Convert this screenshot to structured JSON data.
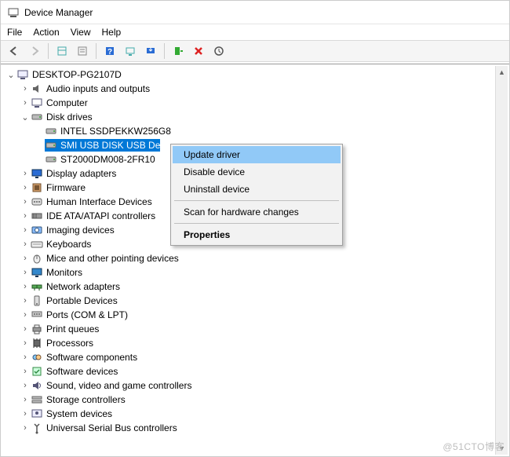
{
  "title": "Device Manager",
  "menubar": [
    "File",
    "Action",
    "View",
    "Help"
  ],
  "toolbar": [
    {
      "name": "back-icon"
    },
    {
      "name": "forward-icon"
    },
    {
      "sep": true
    },
    {
      "name": "show-hidden-icon"
    },
    {
      "name": "properties-pane-icon"
    },
    {
      "sep": true
    },
    {
      "name": "help-icon"
    },
    {
      "name": "scan-icon"
    },
    {
      "name": "update-icon"
    },
    {
      "sep": true
    },
    {
      "name": "add-legacy-icon"
    },
    {
      "name": "uninstall-icon"
    },
    {
      "name": "refresh-icon"
    }
  ],
  "root": {
    "label": "DESKTOP-PG2107D",
    "children": [
      {
        "label": "Audio inputs and outputs",
        "icon": "audio-icon",
        "expanded": false
      },
      {
        "label": "Computer",
        "icon": "computer-icon",
        "expanded": false
      },
      {
        "label": "Disk drives",
        "icon": "disk-icon",
        "expanded": true,
        "children": [
          {
            "label": "INTEL SSDPEKKW256G8",
            "icon": "disk-icon"
          },
          {
            "label": "SMI USB DISK USB De",
            "icon": "disk-icon",
            "selected": true
          },
          {
            "label": "ST2000DM008-2FR10",
            "icon": "disk-icon"
          }
        ]
      },
      {
        "label": "Display adapters",
        "icon": "display-icon",
        "expanded": false
      },
      {
        "label": "Firmware",
        "icon": "firmware-icon",
        "expanded": false
      },
      {
        "label": "Human Interface Devices",
        "icon": "hid-icon",
        "expanded": false
      },
      {
        "label": "IDE ATA/ATAPI controllers",
        "icon": "ide-icon",
        "expanded": false
      },
      {
        "label": "Imaging devices",
        "icon": "imaging-icon",
        "expanded": false
      },
      {
        "label": "Keyboards",
        "icon": "keyboard-icon",
        "expanded": false
      },
      {
        "label": "Mice and other pointing devices",
        "icon": "mouse-icon",
        "expanded": false
      },
      {
        "label": "Monitors",
        "icon": "monitor-icon",
        "expanded": false
      },
      {
        "label": "Network adapters",
        "icon": "network-icon",
        "expanded": false
      },
      {
        "label": "Portable Devices",
        "icon": "portable-icon",
        "expanded": false
      },
      {
        "label": "Ports (COM & LPT)",
        "icon": "ports-icon",
        "expanded": false
      },
      {
        "label": "Print queues",
        "icon": "print-icon",
        "expanded": false
      },
      {
        "label": "Processors",
        "icon": "processor-icon",
        "expanded": false
      },
      {
        "label": "Software components",
        "icon": "swcomp-icon",
        "expanded": false
      },
      {
        "label": "Software devices",
        "icon": "swdev-icon",
        "expanded": false
      },
      {
        "label": "Sound, video and game controllers",
        "icon": "sound-icon",
        "expanded": false
      },
      {
        "label": "Storage controllers",
        "icon": "storage-icon",
        "expanded": false
      },
      {
        "label": "System devices",
        "icon": "system-icon",
        "expanded": false
      },
      {
        "label": "Universal Serial Bus controllers",
        "icon": "usb-icon",
        "expanded": false
      }
    ]
  },
  "context_menu": {
    "items": [
      {
        "label": "Update driver",
        "hover": true
      },
      {
        "label": "Disable device"
      },
      {
        "label": "Uninstall device"
      },
      {
        "sep": true
      },
      {
        "label": "Scan for hardware changes"
      },
      {
        "sep": true
      },
      {
        "label": "Properties",
        "bold": true
      }
    ]
  },
  "watermark": "@51CTO博客"
}
